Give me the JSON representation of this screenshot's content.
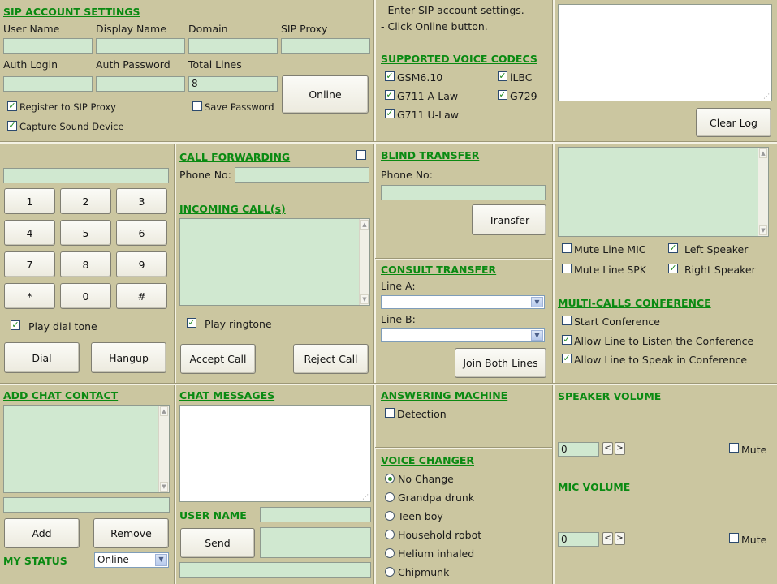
{
  "sip": {
    "title": "SIP ACCOUNT SETTINGS",
    "user_name_label": "User Name",
    "display_name_label": "Display Name",
    "domain_label": "Domain",
    "sip_proxy_label": "SIP Proxy",
    "auth_login_label": "Auth Login",
    "auth_password_label": "Auth Password",
    "total_lines_label": "Total Lines",
    "total_lines_value": "8",
    "online_button": "Online",
    "register_label": "Register to SIP Proxy",
    "register_checked": true,
    "save_password_label": "Save Password",
    "save_password_checked": false,
    "capture_label": "Capture Sound Device",
    "capture_checked": true
  },
  "instructions": {
    "line1": "- Enter SIP account settings.",
    "line2": "- Click Online button."
  },
  "codecs": {
    "title": "SUPPORTED VOICE CODECS",
    "gsm": "GSM6.10",
    "ilbc": "iLBC",
    "g711a": "G711 A-Law",
    "g729": "G729",
    "g711u": "G711 U-Law"
  },
  "log": {
    "clear_button": "Clear Log"
  },
  "dialpad": {
    "keys": [
      "1",
      "2",
      "3",
      "4",
      "5",
      "6",
      "7",
      "8",
      "9",
      "*",
      "0",
      "#"
    ],
    "play_dial_tone": "Play dial tone",
    "dial_button": "Dial",
    "hangup_button": "Hangup"
  },
  "forwarding": {
    "title": "CALL FORWARDING",
    "phone_label": "Phone No:",
    "incoming_title": "INCOMING CALL(s)",
    "play_ringtone": "Play ringtone",
    "accept_button": "Accept Call",
    "reject_button": "Reject Call"
  },
  "blind": {
    "title": "BLIND TRANSFER",
    "phone_label": "Phone No:",
    "transfer_button": "Transfer"
  },
  "consult": {
    "title": "CONSULT TRANSFER",
    "line_a_label": "Line A:",
    "line_b_label": "Line B:",
    "join_button": "Join Both Lines"
  },
  "lines": {
    "mute_mic": "Mute Line MIC",
    "left_speaker": "Left Speaker",
    "mute_spk": "Mute Line SPK",
    "right_speaker": "Right Speaker"
  },
  "conference": {
    "title": "MULTI-CALLS CONFERENCE",
    "start": "Start Conference",
    "listen": "Allow Line to Listen the Conference",
    "speak": "Allow Line to Speak in Conference"
  },
  "chat_contact": {
    "title": "ADD CHAT CONTACT",
    "add_button": "Add",
    "remove_button": "Remove",
    "status_label": "MY STATUS",
    "status_value": "Online"
  },
  "chat_messages": {
    "title": "CHAT MESSAGES",
    "user_name_label": "USER NAME",
    "send_button": "Send"
  },
  "answering": {
    "title": "ANSWERING MACHINE",
    "detection": "Detection"
  },
  "voice_changer": {
    "title": "VOICE CHANGER",
    "options": [
      "No Change",
      "Grandpa drunk",
      "Teen boy",
      "Household robot",
      "Helium inhaled",
      "Chipmunk"
    ]
  },
  "volume": {
    "speaker_title": "SPEAKER VOLUME",
    "speaker_value": "0",
    "mic_title": "MIC VOLUME",
    "mic_value": "0",
    "mute_label": "Mute",
    "dec": "<",
    "inc": ">"
  }
}
